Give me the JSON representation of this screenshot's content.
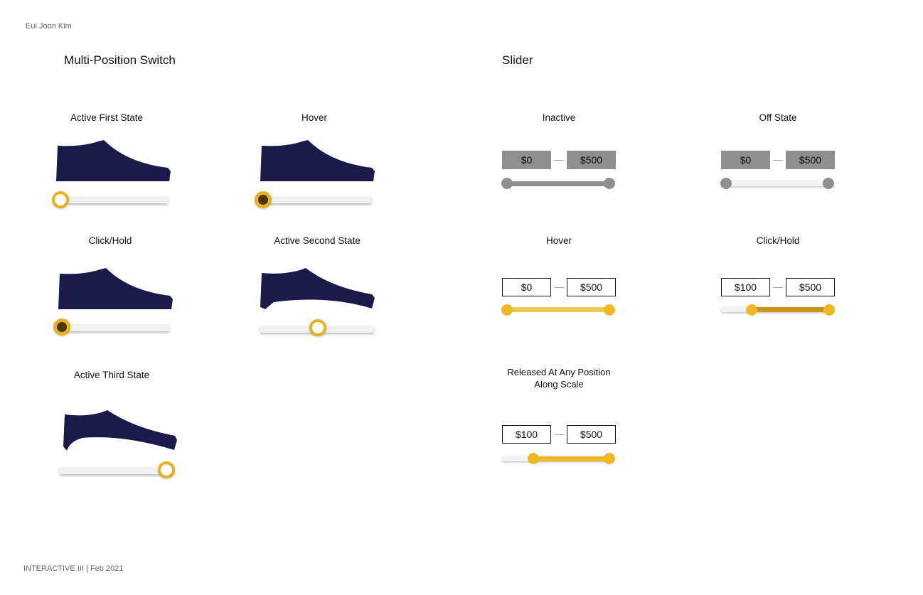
{
  "header": {
    "author": "Eui Joon Kim"
  },
  "footer": {
    "text": "INTERACTIVE III | Feb 2021"
  },
  "multi_switch": {
    "title": "Multi-Position Switch",
    "states": [
      {
        "label": "Active First State",
        "knob": "open",
        "position": 0
      },
      {
        "label": "Hover",
        "knob": "filled",
        "position": 0
      },
      {
        "label": "Click/Hold",
        "knob": "filled",
        "position": 0
      },
      {
        "label": "Active Second State",
        "knob": "open",
        "position": 0.5
      },
      {
        "label": "Active Third State",
        "knob": "open",
        "position": 1
      }
    ],
    "colors": {
      "shoe": "#1b1a4b",
      "knob": "#e7b21f"
    }
  },
  "slider": {
    "title": "Slider",
    "states": [
      {
        "label": "Inactive",
        "min": "$0",
        "max": "$500",
        "low": 0,
        "high": 500
      },
      {
        "label": "Off State",
        "min": "$0",
        "max": "$500",
        "low": 0,
        "high": 500
      },
      {
        "label": "Hover",
        "min": "$0",
        "max": "$500",
        "low": 0,
        "high": 500
      },
      {
        "label": "Click/Hold",
        "min": "$100",
        "max": "$500",
        "low": 100,
        "high": 500
      },
      {
        "label_line1": "Released At Any Position",
        "label_line2": "Along Scale",
        "min": "$100",
        "max": "$500",
        "low": 100,
        "high": 500
      }
    ],
    "colors": {
      "inactive": "#8f8f8f",
      "active": "#efb824",
      "hover_track": "#f3c84e"
    }
  }
}
